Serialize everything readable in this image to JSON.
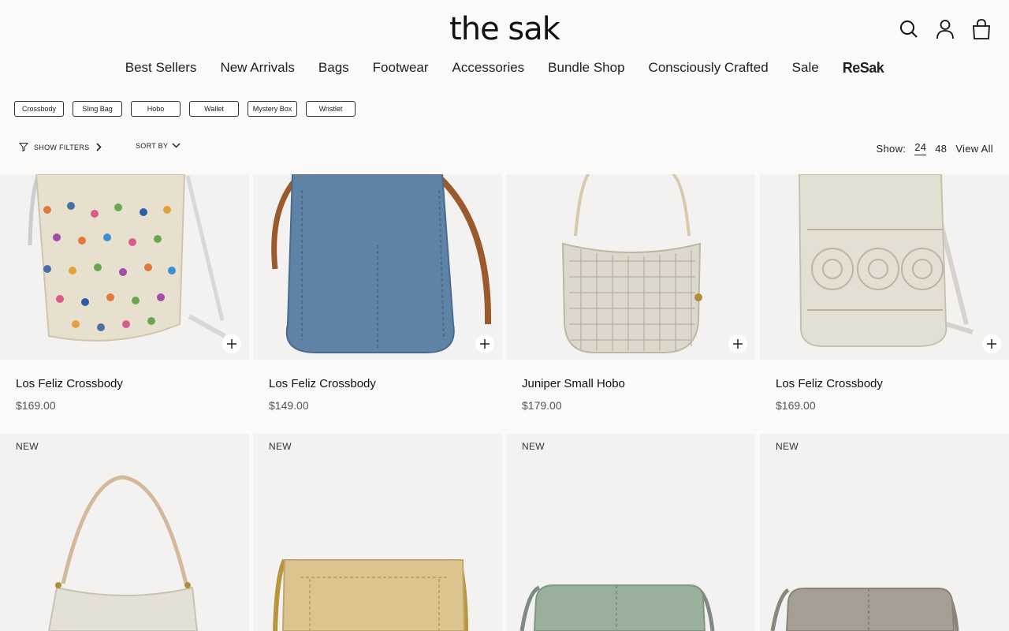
{
  "brand": {
    "logo": "the sak"
  },
  "header_icons": [
    "search-icon",
    "account-icon",
    "bag-icon"
  ],
  "nav": [
    "Best Sellers",
    "New Arrivals",
    "Bags",
    "Footwear",
    "Accessories",
    "Bundle Shop",
    "Consciously Crafted",
    "Sale",
    "ReSak"
  ],
  "chips": [
    "Crossbody",
    "Sling Bag",
    "Hobo",
    "Wallet",
    "Mystery Box",
    "Wristlet"
  ],
  "toolbar": {
    "show_filters": "SHOW FILTERS",
    "sort_by": "SORT BY",
    "show_label": "Show:",
    "counts": [
      "24",
      "48",
      "View All"
    ],
    "active_count": "24"
  },
  "products_row1": [
    {
      "name": "Los Feliz Crossbody",
      "price": "$169.00"
    },
    {
      "name": "Los Feliz Crossbody",
      "price": "$149.00"
    },
    {
      "name": "Juniper Small Hobo",
      "price": "$179.00"
    },
    {
      "name": "Los Feliz Crossbody",
      "price": "$169.00"
    }
  ],
  "products_row2": [
    {
      "badge": "NEW"
    },
    {
      "badge": "NEW"
    },
    {
      "badge": "NEW"
    },
    {
      "badge": "NEW"
    }
  ],
  "colors": {
    "page_bg": "#fbfaf8",
    "card_bg": "#f3f2f0",
    "text": "#1a1a1a",
    "price": "#555555"
  }
}
